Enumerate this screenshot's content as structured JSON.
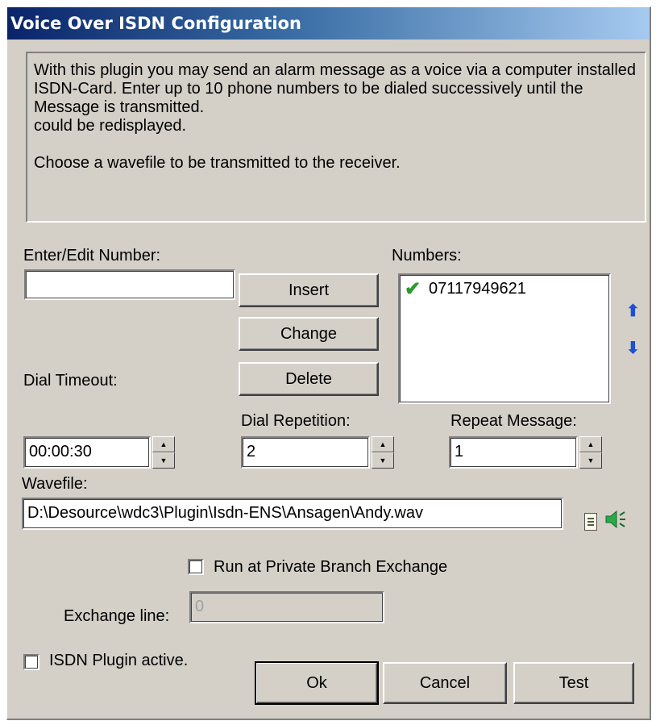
{
  "window": {
    "title": "Voice Over ISDN Configuration"
  },
  "info_text": "With this plugin you may send an alarm message as a voice via a computer installed ISDN-Card. Enter up to 10 phone numbers to be dialed successively until the Message is transmitted.\ncould be redisplayed.\n\nChoose a wavefile to be transmitted to the receiver.",
  "labels": {
    "enter_number": "Enter/Edit Number:",
    "numbers": "Numbers:",
    "dial_timeout": "Dial Timeout:",
    "dial_repetition": "Dial Repetition:",
    "repeat_message": "Repeat Message:",
    "wavefile": "Wavefile:",
    "exchange_line": "Exchange line:"
  },
  "fields": {
    "number_value": "",
    "dial_timeout_value": "00:00:30",
    "dial_repetition_value": "2",
    "repeat_message_value": "1",
    "wavefile_value": "D:\\Desource\\wdc3\\Plugin\\Isdn-ENS\\Ansagen\\Andy.wav",
    "exchange_line_value": "0"
  },
  "buttons": {
    "insert": "Insert",
    "change": "Change",
    "delete": "Delete",
    "ok": "Ok",
    "cancel": "Cancel",
    "test": "Test"
  },
  "numbers_list": [
    {
      "number": "07117949621",
      "icon": "check-icon"
    }
  ],
  "checkboxes": {
    "run_at_pbx": {
      "label": "Run at Private Branch Exchange",
      "checked": false
    },
    "plugin_active": {
      "label": "ISDN Plugin active.",
      "checked": false
    }
  },
  "colors": {
    "title_start": "#0a246a",
    "title_end": "#a6caf0",
    "dialog_bg": "#d4d0c8",
    "check": "#2a9a2a",
    "arrow": "#1c4fd6"
  }
}
